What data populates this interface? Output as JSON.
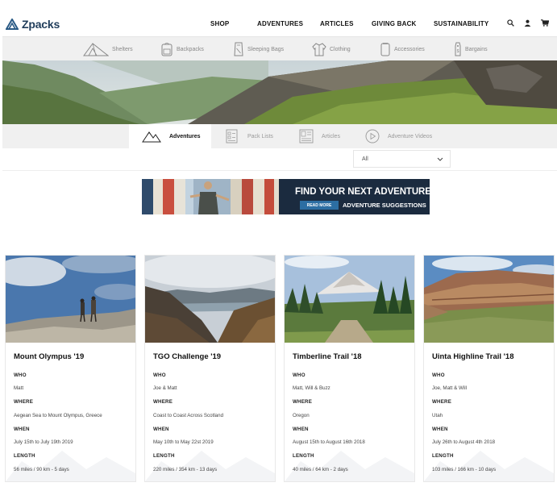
{
  "header": {
    "logo_text": "Zpacks",
    "nav": [
      "SHOP",
      "ADVENTURES",
      "ARTICLES",
      "GIVING BACK",
      "SUSTAINABILITY"
    ],
    "icons": [
      "search-icon",
      "user-icon",
      "cart-icon"
    ]
  },
  "categories": [
    "Shelters",
    "Backpacks",
    "Sleeping Bags",
    "Clothing",
    "Accessories",
    "Bargains"
  ],
  "tabs": [
    "Adventures",
    "Pack Lists",
    "Articles",
    "Adventure Videos"
  ],
  "filter": {
    "selected": "All"
  },
  "banner": {
    "headline": "FIND YOUR NEXT ADVENTURE",
    "button": "READ MORE",
    "subline": "ADVENTURE SUGGESTIONS"
  },
  "cards": [
    {
      "title": "Mount Olympus '19",
      "who_label": "WHO",
      "who": "Matt",
      "where_label": "WHERE",
      "where": "Aegean Sea to Mount Olympus, Greece",
      "when_label": "WHEN",
      "when": "July 15th to July 19th 2019",
      "length_label": "LENGTH",
      "length": "56 miles / 90 km - 5 days"
    },
    {
      "title": "TGO Challenge '19",
      "who_label": "WHO",
      "who": "Joe & Matt",
      "where_label": "WHERE",
      "where": "Coast to Coast Across Scotland",
      "when_label": "WHEN",
      "when": "May 10th to May 22st 2019",
      "length_label": "LENGTH",
      "length": "220 miles / 354 km - 13 days"
    },
    {
      "title": "Timberline Trail '18",
      "who_label": "WHO",
      "who": "Matt, Will & Buzz",
      "where_label": "WHERE",
      "where": "Oregon",
      "when_label": "WHEN",
      "when": "August 15th to August 16th 2018",
      "length_label": "LENGTH",
      "length": "40 miles / 64 km - 2 days"
    },
    {
      "title": "Uinta Highline Trail '18",
      "who_label": "WHO",
      "who": "Joe, Matt & Will",
      "where_label": "WHERE",
      "where": "Utah",
      "when_label": "WHEN",
      "when": "July 26th to August 4th 2018",
      "length_label": "LENGTH",
      "length": "103 miles / 166 km - 10 days"
    }
  ],
  "colors": {
    "brand": "#1f3c5a",
    "accent": "#2c6ea3",
    "bar": "#f0f0f0"
  }
}
